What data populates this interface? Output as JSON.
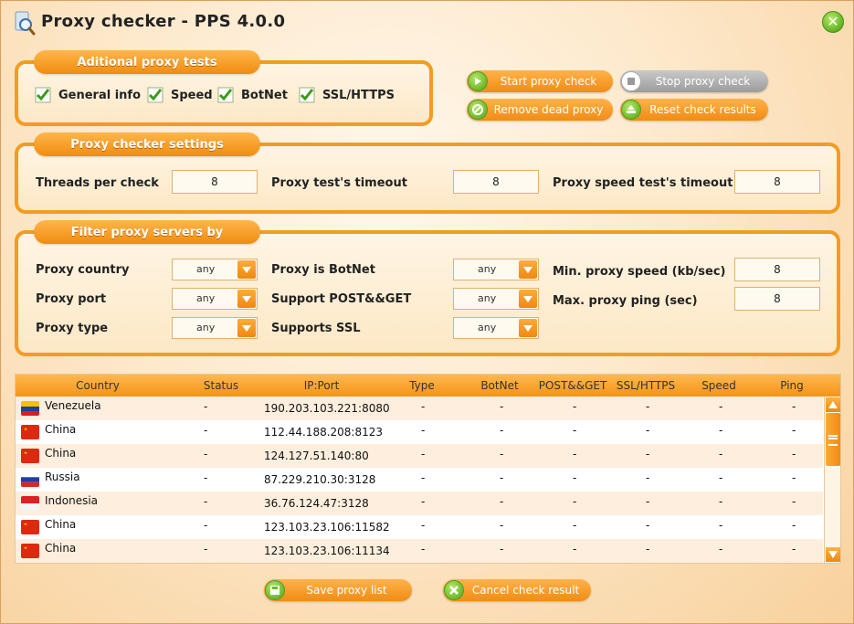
{
  "window": {
    "title": "Proxy checker - PPS 4.0.0",
    "close_label": "✕"
  },
  "tests": {
    "title": "Aditional proxy tests",
    "items": [
      {
        "label": "General info",
        "checked": true
      },
      {
        "label": "Speed",
        "checked": true
      },
      {
        "label": "BotNet",
        "checked": true
      },
      {
        "label": "SSL/HTTPS",
        "checked": true
      }
    ]
  },
  "actions": {
    "start": "Start proxy check",
    "stop": "Stop proxy check",
    "remove": "Remove dead proxy",
    "reset": "Reset check results"
  },
  "settings": {
    "title": "Proxy checker settings",
    "threads_label": "Threads per check",
    "threads_value": "8",
    "timeout_label": "Proxy test's timeout",
    "timeout_value": "8",
    "speed_timeout_label": "Proxy speed test's timeout",
    "speed_timeout_value": "8"
  },
  "filter": {
    "title": "Filter proxy servers by",
    "country_label": "Proxy country",
    "country_value": "any",
    "port_label": "Proxy port",
    "port_value": "any",
    "type_label": "Proxy type",
    "type_value": "any",
    "botnet_label": "Proxy is BotNet",
    "botnet_value": "any",
    "postget_label": "Support POST&&GET",
    "postget_value": "any",
    "ssl_label": "Supports SSL",
    "ssl_value": "any",
    "min_speed_label": "Min. proxy speed (kb/sec)",
    "min_speed_value": "8",
    "max_ping_label": "Max. proxy ping (sec)",
    "max_ping_value": "8"
  },
  "table": {
    "columns": [
      "Country",
      "Status",
      "IP:Port",
      "Type",
      "BotNet",
      "POST&&GET",
      "SSL/HTTPS",
      "Speed",
      "Ping"
    ],
    "rows": [
      {
        "country": "Venezuela",
        "flag": "venezuela-flag-icon",
        "status": "-",
        "ip": "190.203.103.221:8080",
        "type": "-",
        "botnet": "-",
        "postget": "-",
        "ssl": "-",
        "speed": "-",
        "ping": "-"
      },
      {
        "country": "China",
        "flag": "china-flag-icon",
        "status": "-",
        "ip": "112.44.188.208:8123",
        "type": "-",
        "botnet": "-",
        "postget": "-",
        "ssl": "-",
        "speed": "-",
        "ping": "-"
      },
      {
        "country": "China",
        "flag": "china-flag-icon",
        "status": "-",
        "ip": "124.127.51.140:80",
        "type": "-",
        "botnet": "-",
        "postget": "-",
        "ssl": "-",
        "speed": "-",
        "ping": "-"
      },
      {
        "country": "Russia",
        "flag": "russia-flag-icon",
        "status": "-",
        "ip": "87.229.210.30:3128",
        "type": "-",
        "botnet": "-",
        "postget": "-",
        "ssl": "-",
        "speed": "-",
        "ping": "-"
      },
      {
        "country": "Indonesia",
        "flag": "indonesia-flag-icon",
        "status": "-",
        "ip": "36.76.124.47:3128",
        "type": "-",
        "botnet": "-",
        "postget": "-",
        "ssl": "-",
        "speed": "-",
        "ping": "-"
      },
      {
        "country": "China",
        "flag": "china-flag-icon",
        "status": "-",
        "ip": "123.103.23.106:11582",
        "type": "-",
        "botnet": "-",
        "postget": "-",
        "ssl": "-",
        "speed": "-",
        "ping": "-"
      },
      {
        "country": "China",
        "flag": "china-flag-icon",
        "status": "-",
        "ip": "123.103.23.106:11134",
        "type": "-",
        "botnet": "-",
        "postget": "-",
        "ssl": "-",
        "speed": "-",
        "ping": "-"
      }
    ]
  },
  "footer": {
    "save": "Save proxy list",
    "cancel": "Cancel check result"
  },
  "colors": {
    "accent": "#f29c22",
    "green": "#6cbb2a",
    "row_alt": "#fdeedd"
  }
}
